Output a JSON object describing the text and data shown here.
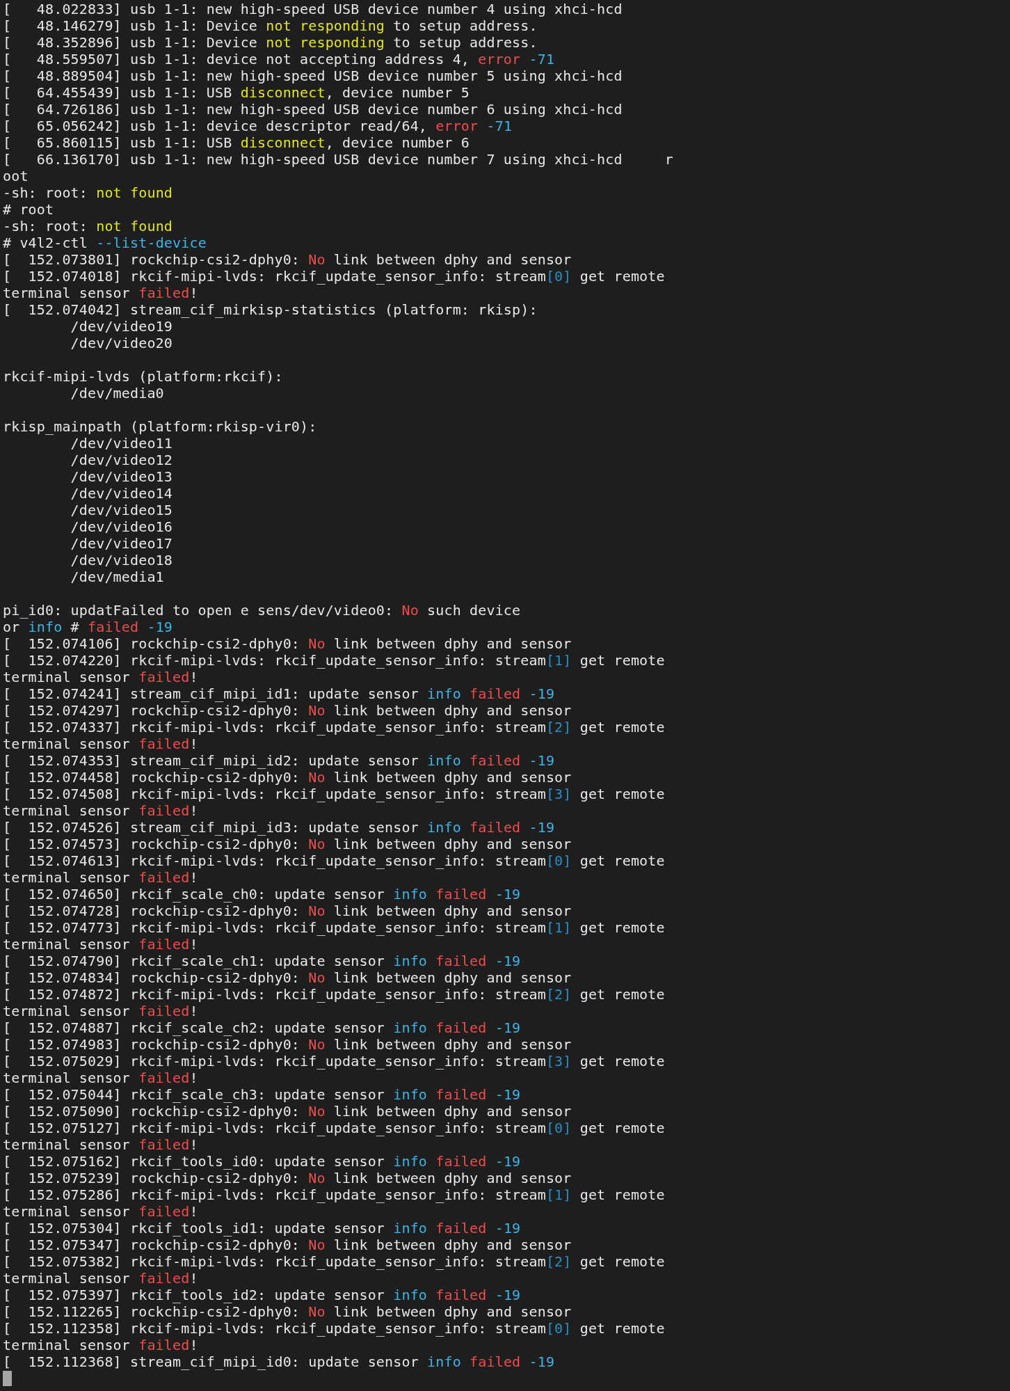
{
  "terminal": {
    "lines": [
      {
        "kind": "text",
        "segments": [
          {
            "text": "[   48.022833] usb 1-1: new high-speed USB device number 4 using xhci-hcd",
            "kind": "plain"
          }
        ]
      },
      {
        "kind": "text",
        "segments": [
          {
            "text": "[   48.146279] usb 1-1: Device ",
            "kind": "plain"
          },
          {
            "text": "not responding",
            "kind": "warning"
          },
          {
            "text": " to setup address.",
            "kind": "plain"
          }
        ]
      },
      {
        "kind": "text",
        "segments": [
          {
            "text": "[   48.352896] usb 1-1: Device ",
            "kind": "plain"
          },
          {
            "text": "not responding",
            "kind": "warning"
          },
          {
            "text": " to setup address.",
            "kind": "plain"
          }
        ]
      },
      {
        "kind": "text",
        "segments": [
          {
            "text": "[   48.559507] usb 1-1: device not accepting address 4, ",
            "kind": "plain"
          },
          {
            "text": "error",
            "kind": "error"
          },
          {
            "text": " -71",
            "kind": "value"
          }
        ]
      },
      {
        "kind": "text",
        "segments": [
          {
            "text": "[   48.889504] usb 1-1: new high-speed USB device number 5 using xhci-hcd",
            "kind": "plain"
          }
        ]
      },
      {
        "kind": "text",
        "segments": [
          {
            "text": "[   64.455439] usb 1-1: USB ",
            "kind": "plain"
          },
          {
            "text": "disconnect",
            "kind": "warning"
          },
          {
            "text": ", device number 5",
            "kind": "plain"
          }
        ]
      },
      {
        "kind": "text",
        "segments": [
          {
            "text": "[   64.726186] usb 1-1: new high-speed USB device number 6 using xhci-hcd",
            "kind": "plain"
          }
        ]
      },
      {
        "kind": "text",
        "segments": [
          {
            "text": "[   65.056242] usb 1-1: device descriptor read/64, ",
            "kind": "plain"
          },
          {
            "text": "error",
            "kind": "error"
          },
          {
            "text": " -71",
            "kind": "value"
          }
        ]
      },
      {
        "kind": "text",
        "segments": [
          {
            "text": "[   65.860115] usb 1-1: USB ",
            "kind": "plain"
          },
          {
            "text": "disconnect",
            "kind": "warning"
          },
          {
            "text": ", device number 6",
            "kind": "plain"
          }
        ]
      },
      {
        "kind": "text",
        "segments": [
          {
            "text": "[   66.136170] usb 1-1: new high-speed USB device number 7 using xhci-hcd     r",
            "kind": "plain"
          }
        ]
      },
      {
        "kind": "text",
        "segments": [
          {
            "text": "oot",
            "kind": "plain"
          }
        ]
      },
      {
        "kind": "text",
        "segments": [
          {
            "text": "-sh: root: ",
            "kind": "plain"
          },
          {
            "text": "not found",
            "kind": "warning"
          }
        ]
      },
      {
        "kind": "text",
        "segments": [
          {
            "text": "# root",
            "kind": "plain"
          }
        ]
      },
      {
        "kind": "text",
        "segments": [
          {
            "text": "-sh: root: ",
            "kind": "plain"
          },
          {
            "text": "not found",
            "kind": "warning"
          }
        ]
      },
      {
        "kind": "text",
        "segments": [
          {
            "text": "# v4l2-ctl ",
            "kind": "plain"
          },
          {
            "text": "--list-device",
            "kind": "value"
          }
        ]
      },
      {
        "kind": "text",
        "segments": [
          {
            "text": "[  152.073801] rockchip-csi2-dphy0: ",
            "kind": "plain"
          },
          {
            "text": "No",
            "kind": "error"
          },
          {
            "text": " link between dphy and sensor",
            "kind": "plain"
          }
        ]
      },
      {
        "kind": "text",
        "segments": [
          {
            "text": "[  152.074018] rkcif-mipi-lvds: rkcif_update_sensor_info: stream",
            "kind": "plain"
          },
          {
            "text": "[0]",
            "kind": "index"
          },
          {
            "text": " get remote",
            "kind": "plain"
          }
        ]
      },
      {
        "kind": "text",
        "segments": [
          {
            "text": "terminal sensor ",
            "kind": "plain"
          },
          {
            "text": "failed",
            "kind": "error"
          },
          {
            "text": "!",
            "kind": "plain"
          }
        ]
      },
      {
        "kind": "text",
        "segments": [
          {
            "text": "[  152.074042] stream_cif_mirkisp-statistics (platform: rkisp):",
            "kind": "plain"
          }
        ]
      },
      {
        "kind": "text",
        "segments": [
          {
            "text": "        /dev/video19",
            "kind": "plain"
          }
        ]
      },
      {
        "kind": "text",
        "segments": [
          {
            "text": "        /dev/video20",
            "kind": "plain"
          }
        ]
      },
      {
        "kind": "blank"
      },
      {
        "kind": "text",
        "segments": [
          {
            "text": "rkcif-mipi-lvds (platform:rkcif):",
            "kind": "plain"
          }
        ]
      },
      {
        "kind": "text",
        "segments": [
          {
            "text": "        /dev/media0",
            "kind": "plain"
          }
        ]
      },
      {
        "kind": "blank"
      },
      {
        "kind": "text",
        "segments": [
          {
            "text": "rkisp_mainpath (platform:rkisp-vir0):",
            "kind": "plain"
          }
        ]
      },
      {
        "kind": "text",
        "segments": [
          {
            "text": "        /dev/video11",
            "kind": "plain"
          }
        ]
      },
      {
        "kind": "text",
        "segments": [
          {
            "text": "        /dev/video12",
            "kind": "plain"
          }
        ]
      },
      {
        "kind": "text",
        "segments": [
          {
            "text": "        /dev/video13",
            "kind": "plain"
          }
        ]
      },
      {
        "kind": "text",
        "segments": [
          {
            "text": "        /dev/video14",
            "kind": "plain"
          }
        ]
      },
      {
        "kind": "text",
        "segments": [
          {
            "text": "        /dev/video15",
            "kind": "plain"
          }
        ]
      },
      {
        "kind": "text",
        "segments": [
          {
            "text": "        /dev/video16",
            "kind": "plain"
          }
        ]
      },
      {
        "kind": "text",
        "segments": [
          {
            "text": "        /dev/video17",
            "kind": "plain"
          }
        ]
      },
      {
        "kind": "text",
        "segments": [
          {
            "text": "        /dev/video18",
            "kind": "plain"
          }
        ]
      },
      {
        "kind": "text",
        "segments": [
          {
            "text": "        /dev/media1",
            "kind": "plain"
          }
        ]
      },
      {
        "kind": "blank"
      },
      {
        "kind": "text",
        "segments": [
          {
            "text": "pi_id0: updatFailed to open e sens/dev/video0: ",
            "kind": "plain"
          },
          {
            "text": "No",
            "kind": "error"
          },
          {
            "text": " such device",
            "kind": "plain"
          }
        ]
      },
      {
        "kind": "text",
        "segments": [
          {
            "text": "or ",
            "kind": "plain"
          },
          {
            "text": "info",
            "kind": "value"
          },
          {
            "text": " # ",
            "kind": "plain"
          },
          {
            "text": "failed",
            "kind": "error"
          },
          {
            "text": " -19",
            "kind": "value"
          }
        ]
      },
      {
        "kind": "text",
        "segments": [
          {
            "text": "[  152.074106] rockchip-csi2-dphy0: ",
            "kind": "plain"
          },
          {
            "text": "No",
            "kind": "error"
          },
          {
            "text": " link between dphy and sensor",
            "kind": "plain"
          }
        ]
      },
      {
        "kind": "text",
        "segments": [
          {
            "text": "[  152.074220] rkcif-mipi-lvds: rkcif_update_sensor_info: stream",
            "kind": "plain"
          },
          {
            "text": "[1]",
            "kind": "index"
          },
          {
            "text": " get remote",
            "kind": "plain"
          }
        ]
      },
      {
        "kind": "text",
        "segments": [
          {
            "text": "terminal sensor ",
            "kind": "plain"
          },
          {
            "text": "failed",
            "kind": "error"
          },
          {
            "text": "!",
            "kind": "plain"
          }
        ]
      },
      {
        "kind": "text",
        "segments": [
          {
            "text": "[  152.074241] stream_cif_mipi_id1: update sensor ",
            "kind": "plain"
          },
          {
            "text": "info",
            "kind": "value"
          },
          {
            "text": " failed",
            "kind": "error"
          },
          {
            "text": " -19",
            "kind": "value"
          }
        ]
      },
      {
        "kind": "text",
        "segments": [
          {
            "text": "[  152.074297] rockchip-csi2-dphy0: ",
            "kind": "plain"
          },
          {
            "text": "No",
            "kind": "error"
          },
          {
            "text": " link between dphy and sensor",
            "kind": "plain"
          }
        ]
      },
      {
        "kind": "text",
        "segments": [
          {
            "text": "[  152.074337] rkcif-mipi-lvds: rkcif_update_sensor_info: stream",
            "kind": "plain"
          },
          {
            "text": "[2]",
            "kind": "index"
          },
          {
            "text": " get remote",
            "kind": "plain"
          }
        ]
      },
      {
        "kind": "text",
        "segments": [
          {
            "text": "terminal sensor ",
            "kind": "plain"
          },
          {
            "text": "failed",
            "kind": "error"
          },
          {
            "text": "!",
            "kind": "plain"
          }
        ]
      },
      {
        "kind": "text",
        "segments": [
          {
            "text": "[  152.074353] stream_cif_mipi_id2: update sensor ",
            "kind": "plain"
          },
          {
            "text": "info",
            "kind": "value"
          },
          {
            "text": " failed",
            "kind": "error"
          },
          {
            "text": " -19",
            "kind": "value"
          }
        ]
      },
      {
        "kind": "text",
        "segments": [
          {
            "text": "[  152.074458] rockchip-csi2-dphy0: ",
            "kind": "plain"
          },
          {
            "text": "No",
            "kind": "error"
          },
          {
            "text": " link between dphy and sensor",
            "kind": "plain"
          }
        ]
      },
      {
        "kind": "text",
        "segments": [
          {
            "text": "[  152.074508] rkcif-mipi-lvds: rkcif_update_sensor_info: stream",
            "kind": "plain"
          },
          {
            "text": "[3]",
            "kind": "index"
          },
          {
            "text": " get remote",
            "kind": "plain"
          }
        ]
      },
      {
        "kind": "text",
        "segments": [
          {
            "text": "terminal sensor ",
            "kind": "plain"
          },
          {
            "text": "failed",
            "kind": "error"
          },
          {
            "text": "!",
            "kind": "plain"
          }
        ]
      },
      {
        "kind": "text",
        "segments": [
          {
            "text": "[  152.074526] stream_cif_mipi_id3: update sensor ",
            "kind": "plain"
          },
          {
            "text": "info",
            "kind": "value"
          },
          {
            "text": " failed",
            "kind": "error"
          },
          {
            "text": " -19",
            "kind": "value"
          }
        ]
      },
      {
        "kind": "text",
        "segments": [
          {
            "text": "[  152.074573] rockchip-csi2-dphy0: ",
            "kind": "plain"
          },
          {
            "text": "No",
            "kind": "error"
          },
          {
            "text": " link between dphy and sensor",
            "kind": "plain"
          }
        ]
      },
      {
        "kind": "text",
        "segments": [
          {
            "text": "[  152.074613] rkcif-mipi-lvds: rkcif_update_sensor_info: stream",
            "kind": "plain"
          },
          {
            "text": "[0]",
            "kind": "index"
          },
          {
            "text": " get remote",
            "kind": "plain"
          }
        ]
      },
      {
        "kind": "text",
        "segments": [
          {
            "text": "terminal sensor ",
            "kind": "plain"
          },
          {
            "text": "failed",
            "kind": "error"
          },
          {
            "text": "!",
            "kind": "plain"
          }
        ]
      },
      {
        "kind": "text",
        "segments": [
          {
            "text": "[  152.074650] rkcif_scale_ch0: update sensor ",
            "kind": "plain"
          },
          {
            "text": "info",
            "kind": "value"
          },
          {
            "text": " failed",
            "kind": "error"
          },
          {
            "text": " -19",
            "kind": "value"
          }
        ]
      },
      {
        "kind": "text",
        "segments": [
          {
            "text": "[  152.074728] rockchip-csi2-dphy0: ",
            "kind": "plain"
          },
          {
            "text": "No",
            "kind": "error"
          },
          {
            "text": " link between dphy and sensor",
            "kind": "plain"
          }
        ]
      },
      {
        "kind": "text",
        "segments": [
          {
            "text": "[  152.074773] rkcif-mipi-lvds: rkcif_update_sensor_info: stream",
            "kind": "plain"
          },
          {
            "text": "[1]",
            "kind": "index"
          },
          {
            "text": " get remote",
            "kind": "plain"
          }
        ]
      },
      {
        "kind": "text",
        "segments": [
          {
            "text": "terminal sensor ",
            "kind": "plain"
          },
          {
            "text": "failed",
            "kind": "error"
          },
          {
            "text": "!",
            "kind": "plain"
          }
        ]
      },
      {
        "kind": "text",
        "segments": [
          {
            "text": "[  152.074790] rkcif_scale_ch1: update sensor ",
            "kind": "plain"
          },
          {
            "text": "info",
            "kind": "value"
          },
          {
            "text": " failed",
            "kind": "error"
          },
          {
            "text": " -19",
            "kind": "value"
          }
        ]
      },
      {
        "kind": "text",
        "segments": [
          {
            "text": "[  152.074834] rockchip-csi2-dphy0: ",
            "kind": "plain"
          },
          {
            "text": "No",
            "kind": "error"
          },
          {
            "text": " link between dphy and sensor",
            "kind": "plain"
          }
        ]
      },
      {
        "kind": "text",
        "segments": [
          {
            "text": "[  152.074872] rkcif-mipi-lvds: rkcif_update_sensor_info: stream",
            "kind": "plain"
          },
          {
            "text": "[2]",
            "kind": "index"
          },
          {
            "text": " get remote",
            "kind": "plain"
          }
        ]
      },
      {
        "kind": "text",
        "segments": [
          {
            "text": "terminal sensor ",
            "kind": "plain"
          },
          {
            "text": "failed",
            "kind": "error"
          },
          {
            "text": "!",
            "kind": "plain"
          }
        ]
      },
      {
        "kind": "text",
        "segments": [
          {
            "text": "[  152.074887] rkcif_scale_ch2: update sensor ",
            "kind": "plain"
          },
          {
            "text": "info",
            "kind": "value"
          },
          {
            "text": " failed",
            "kind": "error"
          },
          {
            "text": " -19",
            "kind": "value"
          }
        ]
      },
      {
        "kind": "text",
        "segments": [
          {
            "text": "[  152.074983] rockchip-csi2-dphy0: ",
            "kind": "plain"
          },
          {
            "text": "No",
            "kind": "error"
          },
          {
            "text": " link between dphy and sensor",
            "kind": "plain"
          }
        ]
      },
      {
        "kind": "text",
        "segments": [
          {
            "text": "[  152.075029] rkcif-mipi-lvds: rkcif_update_sensor_info: stream",
            "kind": "plain"
          },
          {
            "text": "[3]",
            "kind": "index"
          },
          {
            "text": " get remote",
            "kind": "plain"
          }
        ]
      },
      {
        "kind": "text",
        "segments": [
          {
            "text": "terminal sensor ",
            "kind": "plain"
          },
          {
            "text": "failed",
            "kind": "error"
          },
          {
            "text": "!",
            "kind": "plain"
          }
        ]
      },
      {
        "kind": "text",
        "segments": [
          {
            "text": "[  152.075044] rkcif_scale_ch3: update sensor ",
            "kind": "plain"
          },
          {
            "text": "info",
            "kind": "value"
          },
          {
            "text": " failed",
            "kind": "error"
          },
          {
            "text": " -19",
            "kind": "value"
          }
        ]
      },
      {
        "kind": "text",
        "segments": [
          {
            "text": "[  152.075090] rockchip-csi2-dphy0: ",
            "kind": "plain"
          },
          {
            "text": "No",
            "kind": "error"
          },
          {
            "text": " link between dphy and sensor",
            "kind": "plain"
          }
        ]
      },
      {
        "kind": "text",
        "segments": [
          {
            "text": "[  152.075127] rkcif-mipi-lvds: rkcif_update_sensor_info: stream",
            "kind": "plain"
          },
          {
            "text": "[0]",
            "kind": "index"
          },
          {
            "text": " get remote",
            "kind": "plain"
          }
        ]
      },
      {
        "kind": "text",
        "segments": [
          {
            "text": "terminal sensor ",
            "kind": "plain"
          },
          {
            "text": "failed",
            "kind": "error"
          },
          {
            "text": "!",
            "kind": "plain"
          }
        ]
      },
      {
        "kind": "text",
        "segments": [
          {
            "text": "[  152.075162] rkcif_tools_id0: update sensor ",
            "kind": "plain"
          },
          {
            "text": "info",
            "kind": "value"
          },
          {
            "text": " failed",
            "kind": "error"
          },
          {
            "text": " -19",
            "kind": "value"
          }
        ]
      },
      {
        "kind": "text",
        "segments": [
          {
            "text": "[  152.075239] rockchip-csi2-dphy0: ",
            "kind": "plain"
          },
          {
            "text": "No",
            "kind": "error"
          },
          {
            "text": " link between dphy and sensor",
            "kind": "plain"
          }
        ]
      },
      {
        "kind": "text",
        "segments": [
          {
            "text": "[  152.075286] rkcif-mipi-lvds: rkcif_update_sensor_info: stream",
            "kind": "plain"
          },
          {
            "text": "[1]",
            "kind": "index"
          },
          {
            "text": " get remote",
            "kind": "plain"
          }
        ]
      },
      {
        "kind": "text",
        "segments": [
          {
            "text": "terminal sensor ",
            "kind": "plain"
          },
          {
            "text": "failed",
            "kind": "error"
          },
          {
            "text": "!",
            "kind": "plain"
          }
        ]
      },
      {
        "kind": "text",
        "segments": [
          {
            "text": "[  152.075304] rkcif_tools_id1: update sensor ",
            "kind": "plain"
          },
          {
            "text": "info",
            "kind": "value"
          },
          {
            "text": " failed",
            "kind": "error"
          },
          {
            "text": " -19",
            "kind": "value"
          }
        ]
      },
      {
        "kind": "text",
        "segments": [
          {
            "text": "[  152.075347] rockchip-csi2-dphy0: ",
            "kind": "plain"
          },
          {
            "text": "No",
            "kind": "error"
          },
          {
            "text": " link between dphy and sensor",
            "kind": "plain"
          }
        ]
      },
      {
        "kind": "text",
        "segments": [
          {
            "text": "[  152.075382] rkcif-mipi-lvds: rkcif_update_sensor_info: stream",
            "kind": "plain"
          },
          {
            "text": "[2]",
            "kind": "index"
          },
          {
            "text": " get remote",
            "kind": "plain"
          }
        ]
      },
      {
        "kind": "text",
        "segments": [
          {
            "text": "terminal sensor ",
            "kind": "plain"
          },
          {
            "text": "failed",
            "kind": "error"
          },
          {
            "text": "!",
            "kind": "plain"
          }
        ]
      },
      {
        "kind": "text",
        "segments": [
          {
            "text": "[  152.075397] rkcif_tools_id2: update sensor ",
            "kind": "plain"
          },
          {
            "text": "info",
            "kind": "value"
          },
          {
            "text": " failed",
            "kind": "error"
          },
          {
            "text": " -19",
            "kind": "value"
          }
        ]
      },
      {
        "kind": "text",
        "segments": [
          {
            "text": "[  152.112265] rockchip-csi2-dphy0: ",
            "kind": "plain"
          },
          {
            "text": "No",
            "kind": "error"
          },
          {
            "text": " link between dphy and sensor",
            "kind": "plain"
          }
        ]
      },
      {
        "kind": "text",
        "segments": [
          {
            "text": "[  152.112358] rkcif-mipi-lvds: rkcif_update_sensor_info: stream",
            "kind": "plain"
          },
          {
            "text": "[0]",
            "kind": "index"
          },
          {
            "text": " get remote",
            "kind": "plain"
          }
        ]
      },
      {
        "kind": "text",
        "segments": [
          {
            "text": "terminal sensor ",
            "kind": "plain"
          },
          {
            "text": "failed",
            "kind": "error"
          },
          {
            "text": "!",
            "kind": "plain"
          }
        ]
      },
      {
        "kind": "text",
        "segments": [
          {
            "text": "[  152.112368] stream_cif_mipi_id0: update sensor ",
            "kind": "plain"
          },
          {
            "text": "info",
            "kind": "value"
          },
          {
            "text": " failed",
            "kind": "error"
          },
          {
            "text": " -19",
            "kind": "value"
          }
        ]
      }
    ]
  }
}
